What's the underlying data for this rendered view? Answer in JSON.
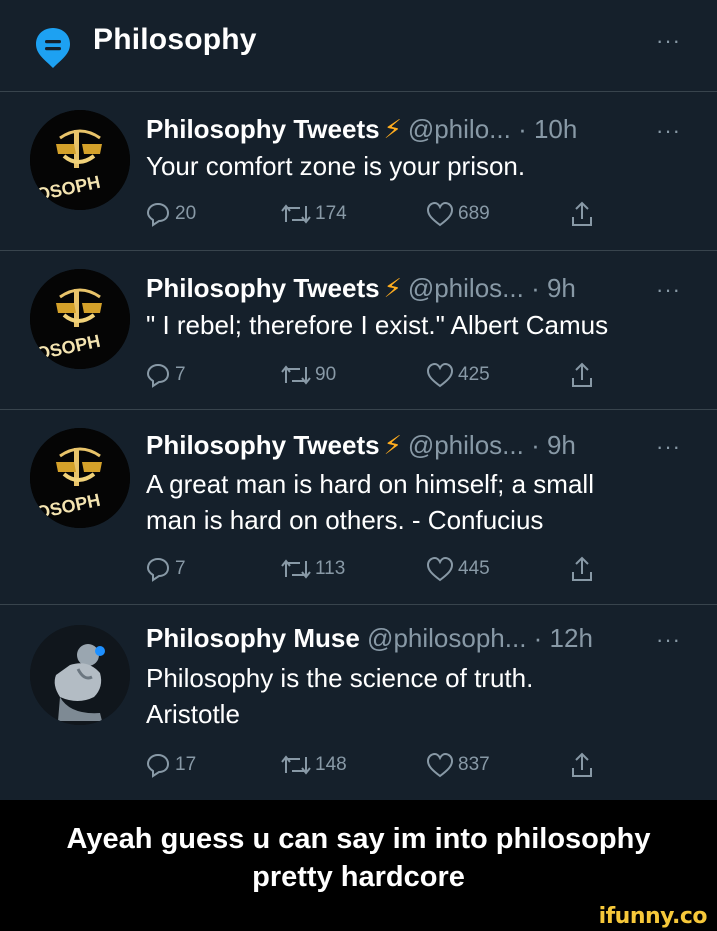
{
  "header": {
    "title": "Philosophy",
    "more_icon": "more-horizontal-icon",
    "topic_icon": "topic-chat-bubble-icon",
    "accent": "#1da1f2"
  },
  "colors": {
    "background": "#15202b",
    "divider": "#38444d",
    "secondary_text": "#8899a6",
    "bolt": "#ffad1f",
    "watermark": "#f6c83a"
  },
  "avatar_text": "OSOPH",
  "tweets": [
    {
      "name": "Philosophy Tweets",
      "verified_bolt": "⚡",
      "handle": "@philo...",
      "time": "· 10h",
      "text_lines": [
        "Your comfort zone is your prison."
      ],
      "replies": "20",
      "retweets": "174",
      "likes": "689"
    },
    {
      "name": "Philosophy Tweets",
      "verified_bolt": "⚡",
      "handle": "@philos...",
      "time": "· 9h",
      "text_lines": [
        "\" I rebel; therefore I exist.\" Albert Camus"
      ],
      "replies": "7",
      "retweets": "90",
      "likes": "425"
    },
    {
      "name": "Philosophy Tweets",
      "verified_bolt": "⚡",
      "handle": "@philos...",
      "time": "· 9h",
      "text_lines": [
        "A great man is hard on himself; a small",
        "man is hard on others. - Confucius"
      ],
      "replies": "7",
      "retweets": "113",
      "likes": "445"
    },
    {
      "name": "Philosophy Muse",
      "verified_bolt": "",
      "handle": "@philosoph...",
      "time": "· 12h",
      "text_lines": [
        "Philosophy is the science of truth.",
        "Aristotle"
      ],
      "replies": "17",
      "retweets": "148",
      "likes": "837"
    }
  ],
  "caption": {
    "line1": "Ayeah guess u can say im into philosophy",
    "line2": "pretty hardcore"
  },
  "watermark": "ifunny.co"
}
